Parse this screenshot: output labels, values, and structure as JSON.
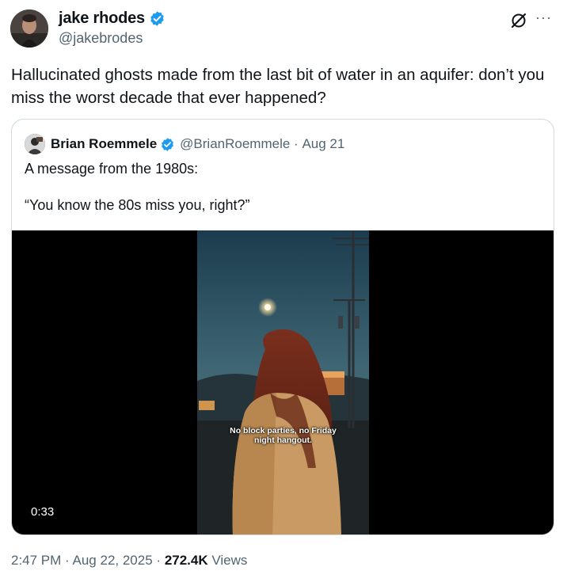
{
  "author": {
    "display_name": "jake rhodes",
    "handle": "@jakebrodes",
    "avatar_icon": "profile-photo-icon",
    "verified_icon": "verified-badge-icon",
    "verified_color": "#1d9bf0"
  },
  "actions": {
    "grok_icon": "grok-icon",
    "more_label": "···"
  },
  "tweet": {
    "text": "Hallucinated ghosts made from the last bit of water in an aquifer: don’t you miss the worst decade that ever happened?"
  },
  "quoted": {
    "display_name": "Brian Roemmele",
    "handle": "@BrianRoemmele",
    "separator": "·",
    "date": "Aug 21",
    "text_line1": "A message from the 1980s:",
    "text_line2": "“You know the 80s miss you, right?”",
    "video": {
      "caption_line1": "No block parties, no Friday",
      "caption_line2": "night hangout.",
      "duration": "0:33"
    }
  },
  "meta": {
    "time": "2:47 PM",
    "separator": "·",
    "date": "Aug 22, 2025",
    "views_count": "272.4K",
    "views_label": "Views"
  }
}
